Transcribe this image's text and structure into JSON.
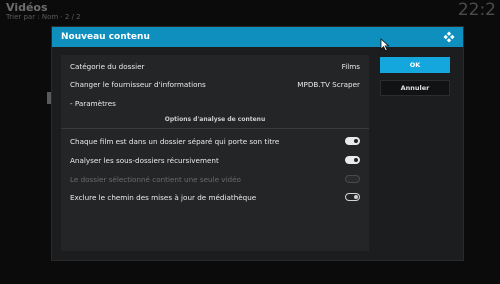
{
  "background": {
    "title": "Vidéos",
    "subtitle": "Trier par : Nom · 2 / 2",
    "clock": "22:2"
  },
  "dialog": {
    "title": "Nouveau contenu",
    "logo_icon": "kodi-logo-icon"
  },
  "rows": [
    {
      "label": "Catégorie du dossier",
      "value": "Films"
    },
    {
      "label": "Changer le fournisseur d'informations",
      "value": "MPDB.TV Scraper"
    },
    {
      "label": "- Paramètres",
      "value": ""
    }
  ],
  "scan_section": {
    "header": "Options d'analyse de contenu",
    "options": [
      {
        "label": "Chaque film est dans un dossier séparé qui porte son titre",
        "state": "on",
        "enabled": true
      },
      {
        "label": "Analyser les sous-dossiers récursivement",
        "state": "on",
        "enabled": true
      },
      {
        "label": "Le dossier sélectionné contient une seule vidéo",
        "state": "off",
        "enabled": false
      },
      {
        "label": "Exclure le chemin des mises à jour de médiathèque",
        "state": "off",
        "enabled": true
      }
    ]
  },
  "buttons": {
    "ok": "OK",
    "cancel": "Annuler"
  },
  "colors": {
    "header": "#0f8fbe",
    "ok_button": "#13a7de"
  }
}
